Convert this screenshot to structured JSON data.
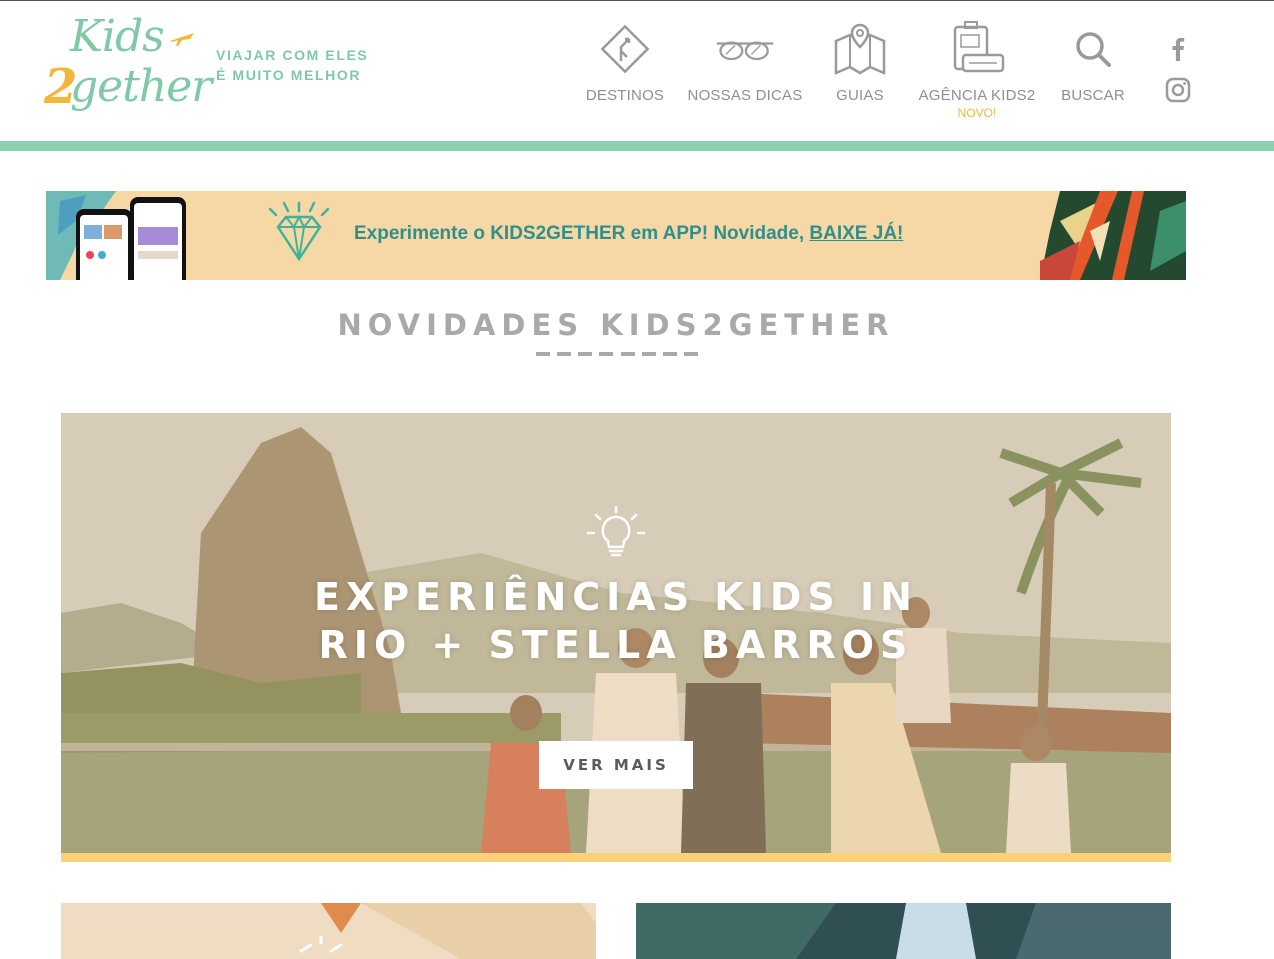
{
  "brand": {
    "logo_line1": "Kids",
    "logo_digit": "2",
    "logo_line2": "gether",
    "tagline_line1": "VIAJAR COM ELES",
    "tagline_line2": "É MUITO MELHOR",
    "colors": {
      "mint": "#7fc9a6",
      "yellow": "#f2b63a",
      "stripe": "#8dd0b0",
      "gray": "#8f8f8f"
    }
  },
  "nav": {
    "items": [
      {
        "label": "DESTINOS",
        "icon": "road-sign-icon"
      },
      {
        "label": "NOSSAS DICAS",
        "icon": "sunglasses-icon"
      },
      {
        "label": "GUIAS",
        "icon": "map-icon"
      },
      {
        "label": "AGÊNCIA KIDS2",
        "icon": "luggage-icon",
        "badge": "NOVO!"
      },
      {
        "label": "BUSCAR",
        "icon": "search-icon"
      }
    ],
    "social": [
      "facebook-icon",
      "instagram-icon"
    ]
  },
  "promo": {
    "text_prefix": "Experimente o KIDS2GETHER em APP! Novidade, ",
    "link": "BAIXE JÁ!"
  },
  "section": {
    "title": "NOVIDADES KIDS2GETHER"
  },
  "hero": {
    "title_line1": "EXPERIÊNCIAS KIDS IN",
    "title_line2": "RIO + STELLA BARROS",
    "button": "VER MAIS",
    "icon": "lightbulb-icon"
  }
}
